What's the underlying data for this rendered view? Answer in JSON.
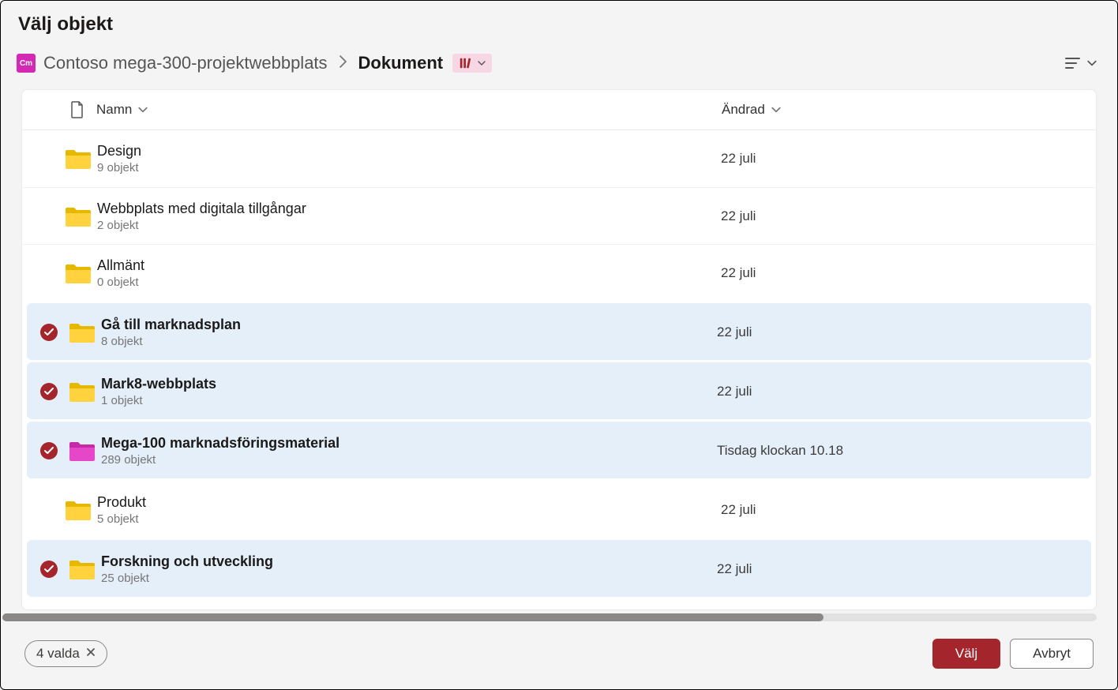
{
  "dialog": {
    "title": "Välj objekt"
  },
  "breadcrumb": {
    "site_badge": "Cm",
    "site_name": "Contoso mega-300-projektwebbplats",
    "current": "Dokument"
  },
  "columns": {
    "name": "Namn",
    "modified": "Ändrad"
  },
  "rows": [
    {
      "name": "Design",
      "sub": "9 objekt",
      "modified": "22 juli",
      "selected": false,
      "color": "yellow"
    },
    {
      "name": "Webbplats med digitala tillgångar",
      "sub": "2 objekt",
      "modified": "22 juli",
      "selected": false,
      "color": "yellow"
    },
    {
      "name": "Allmänt",
      "sub": "0 objekt",
      "modified": "22 juli",
      "selected": false,
      "color": "yellow"
    },
    {
      "name": "Gå till marknadsplan",
      "sub": "8 objekt",
      "modified": "22 juli",
      "selected": true,
      "color": "yellow"
    },
    {
      "name": "Mark8-webbplats",
      "sub": "1 objekt",
      "modified": "22 juli",
      "selected": true,
      "color": "yellow"
    },
    {
      "name": "Mega-100 marknadsföringsmaterial",
      "sub": "289 objekt",
      "modified": "Tisdag klockan 10.18",
      "selected": true,
      "color": "pink"
    },
    {
      "name": "Produkt",
      "sub": "5 objekt",
      "modified": "22 juli",
      "selected": false,
      "color": "yellow"
    },
    {
      "name": "Forskning och utveckling",
      "sub": "25 objekt",
      "modified": "22 juli",
      "selected": true,
      "color": "yellow"
    }
  ],
  "footer": {
    "selected_label": "4 valda",
    "select": "Välj",
    "cancel": "Avbryt"
  }
}
